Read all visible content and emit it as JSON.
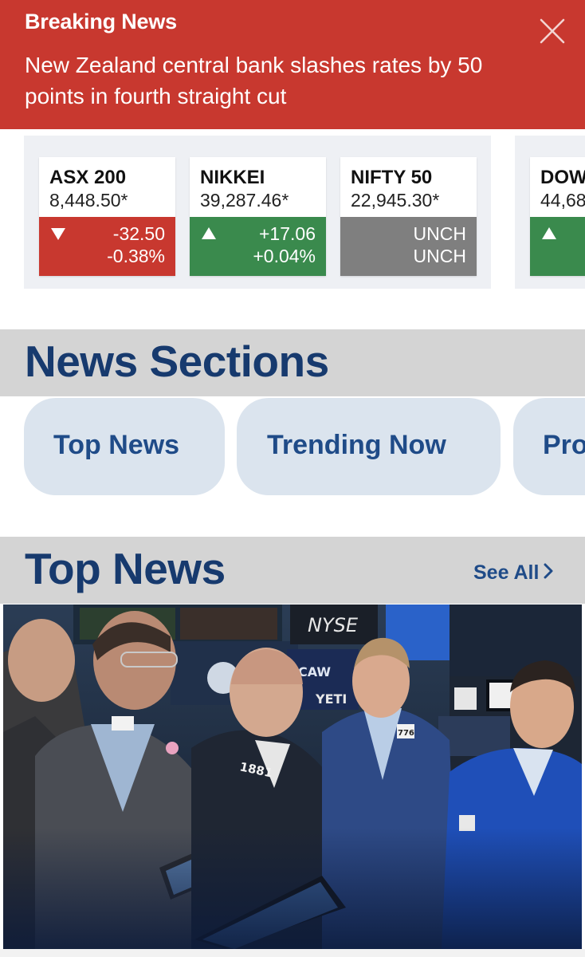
{
  "breaking": {
    "kicker": "Breaking News",
    "headline": "New Zealand central bank slashes rates by 50 points in fourth straight cut",
    "close_icon": "close-icon",
    "color": "#c8382f"
  },
  "markets": [
    {
      "symbol": "ASX 200",
      "price": "8,448.50*",
      "change": "-32.50",
      "change_pct": "-0.38%",
      "direction": "down"
    },
    {
      "symbol": "NIKKEI",
      "price": "39,287.46*",
      "change": "+17.06",
      "change_pct": "+0.04%",
      "direction": "up"
    },
    {
      "symbol": "NIFTY 50",
      "price": "22,945.30*",
      "change": "UNCH",
      "change_pct": "UNCH",
      "direction": "flat"
    },
    {
      "symbol": "DOW",
      "price": "44,68",
      "change": "",
      "change_pct": "",
      "direction": "up"
    }
  ],
  "colors": {
    "down": "#c8382f",
    "up": "#3a8a4d",
    "flat": "#7f7f7f",
    "navy": "#173a6e",
    "pill_bg": "#dbe4ee"
  },
  "news_sections": {
    "title": "News Sections",
    "pills": [
      "Top News",
      "Trending Now",
      "Pro"
    ]
  },
  "top_news": {
    "title": "Top News",
    "see_all": "See All",
    "see_all_icon": "chevron-right-icon",
    "image_signage": {
      "nyse": "NYSE",
      "badge_1": "1881",
      "badge_2": "776",
      "screen_1": "CAW",
      "screen_2": "YETI"
    }
  }
}
